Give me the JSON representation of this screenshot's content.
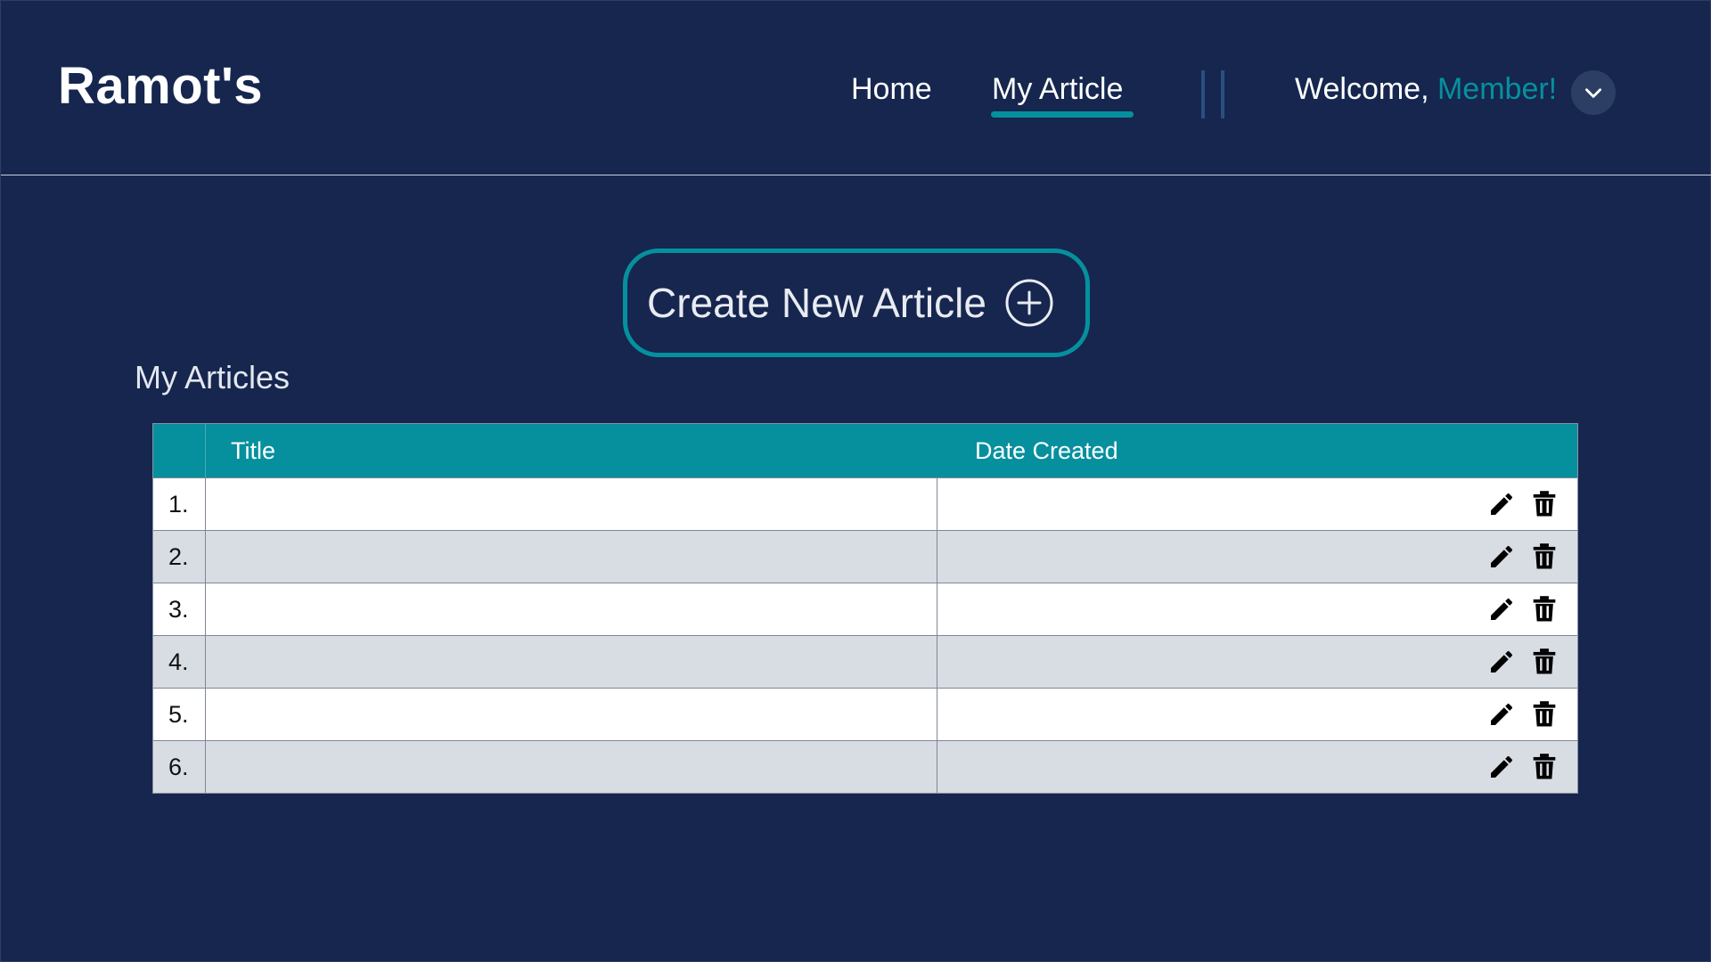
{
  "header": {
    "brand": "Ramot's",
    "nav": [
      {
        "label": "Home"
      },
      {
        "label": "My Article",
        "active": true
      }
    ],
    "welcome_prefix": "Welcome,",
    "welcome_user": "Member!"
  },
  "create_button": {
    "label": "Create New Article",
    "icon": "plus-circle-icon"
  },
  "section_title": "My Articles",
  "table": {
    "columns": [
      "",
      "Title",
      "Date Created"
    ],
    "rows": [
      {
        "num": "1.",
        "title": "",
        "date": ""
      },
      {
        "num": "2.",
        "title": "",
        "date": ""
      },
      {
        "num": "3.",
        "title": "",
        "date": ""
      },
      {
        "num": "4.",
        "title": "",
        "date": ""
      },
      {
        "num": "5.",
        "title": "",
        "date": ""
      },
      {
        "num": "6.",
        "title": "",
        "date": ""
      }
    ],
    "row_actions": [
      "pencil-icon",
      "trash-icon"
    ]
  },
  "colors": {
    "background": "#16264e",
    "accent": "#06909e",
    "row_alt": "#d8dde4"
  }
}
